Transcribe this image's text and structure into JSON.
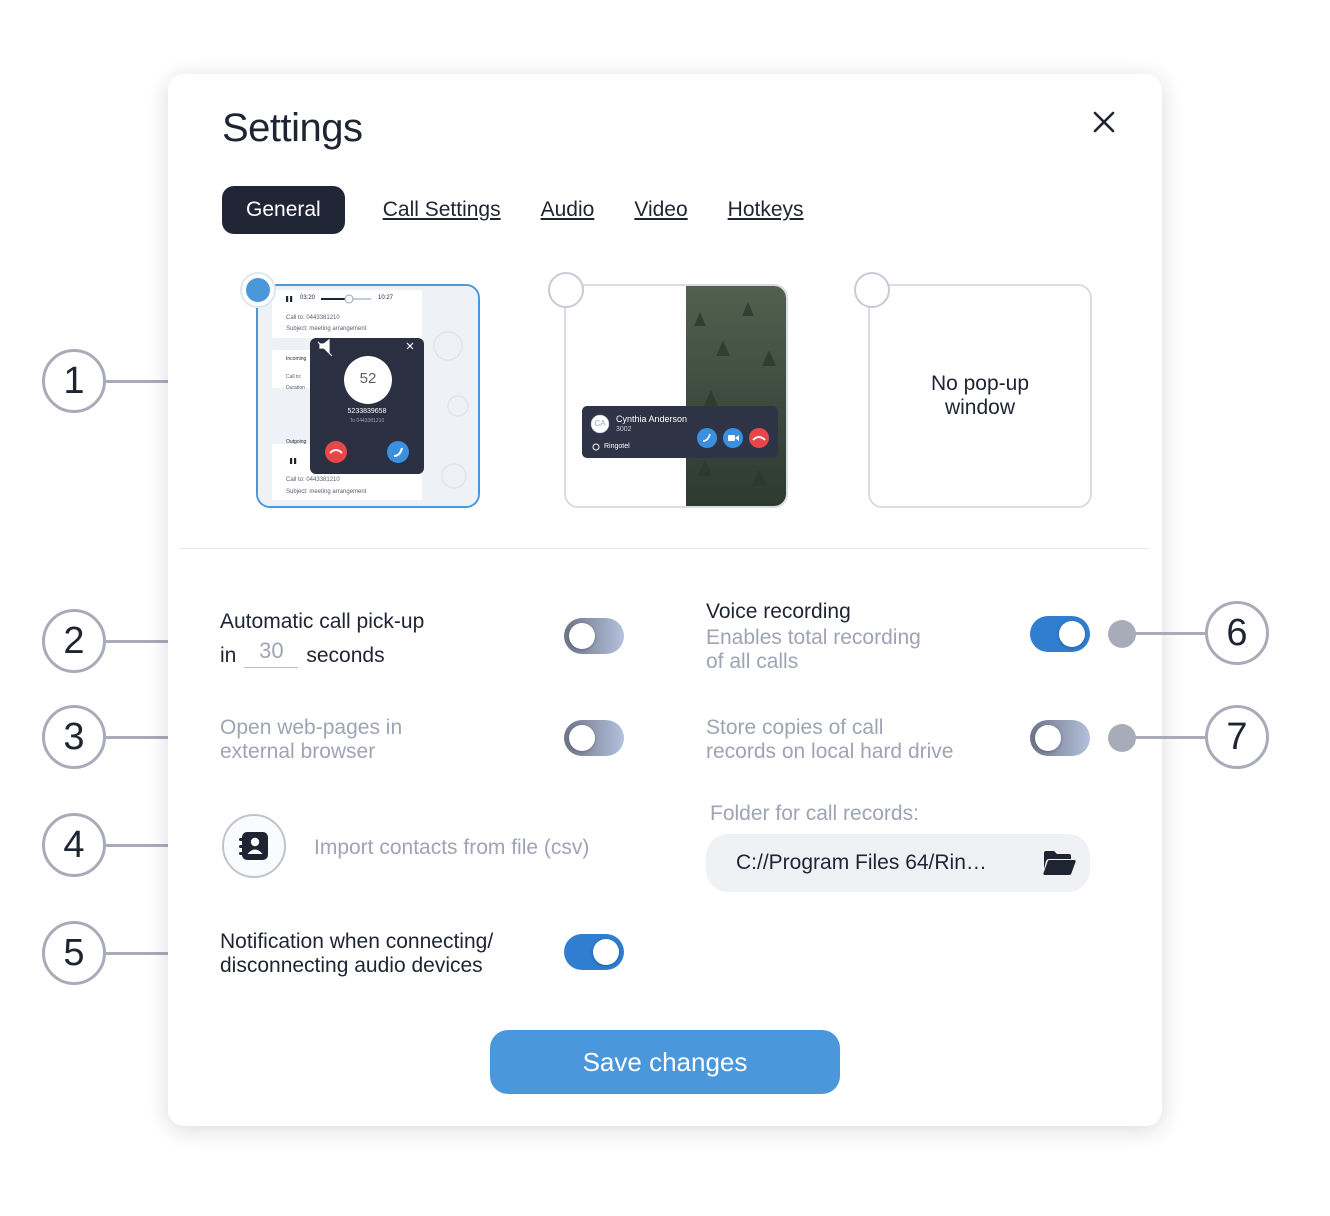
{
  "dialog": {
    "title": "Settings",
    "close_icon": "close-icon"
  },
  "tabs": [
    {
      "label": "General",
      "active": true
    },
    {
      "label": "Call Settings",
      "active": false
    },
    {
      "label": "Audio",
      "active": false
    },
    {
      "label": "Video",
      "active": false
    },
    {
      "label": "Hotkeys",
      "active": false
    }
  ],
  "popup_options": {
    "selected_index": 0,
    "compact": {
      "player_time_start": "03:20",
      "player_time_end": "10:27",
      "call_to": "Call to: 0443381210",
      "subject": "Subject: meeting arrangement",
      "incoming_label": "Incoming",
      "call_to_short": "Call to:",
      "duration_label": "Duration",
      "outgoing_label": "Outgoing",
      "dialer_number": "52",
      "caller_number": "5233839658",
      "caller_to": "To 0443381210",
      "call_to_bottom": "Call to: 0443381210",
      "subject_bottom": "Subject: meeting arrangement"
    },
    "video_overlay": {
      "avatar_initials": "CA",
      "caller_name": "Cynthia Anderson",
      "caller_ext": "3002",
      "app_name": "Ringotel"
    },
    "none_label": "No pop-up window"
  },
  "settings": {
    "auto_pickup": {
      "label_line1": "Automatic call pick-up",
      "label_in": "in",
      "seconds_value": "30",
      "label_seconds": "seconds",
      "enabled": false
    },
    "open_web_pages": {
      "label_line1": "Open web-pages in",
      "label_line2": "external browser",
      "enabled": false
    },
    "import_contacts": {
      "label": "Import contacts from file (csv)",
      "icon": "contacts-book-icon"
    },
    "device_notification": {
      "label_line1": "Notification when connecting/",
      "label_line2": "disconnecting audio devices",
      "enabled": true
    },
    "voice_recording": {
      "label": "Voice recording",
      "desc_line1": "Enables total recording",
      "desc_line2": "of all calls",
      "enabled": true
    },
    "store_copies": {
      "label_line1": "Store copies of call",
      "label_line2": "records on local hard drive",
      "enabled": false
    },
    "folder": {
      "label": "Folder for call records:",
      "path": "C://Program Files 64/Rin…",
      "icon": "folder-open-icon"
    }
  },
  "save_button": "Save changes",
  "callouts": [
    "1",
    "2",
    "3",
    "4",
    "5",
    "6",
    "7"
  ],
  "colors": {
    "accent": "#4a97dc",
    "toggle_on": "#2f7ed0",
    "dark": "#212637",
    "callout_gray": "#a8acb8"
  }
}
